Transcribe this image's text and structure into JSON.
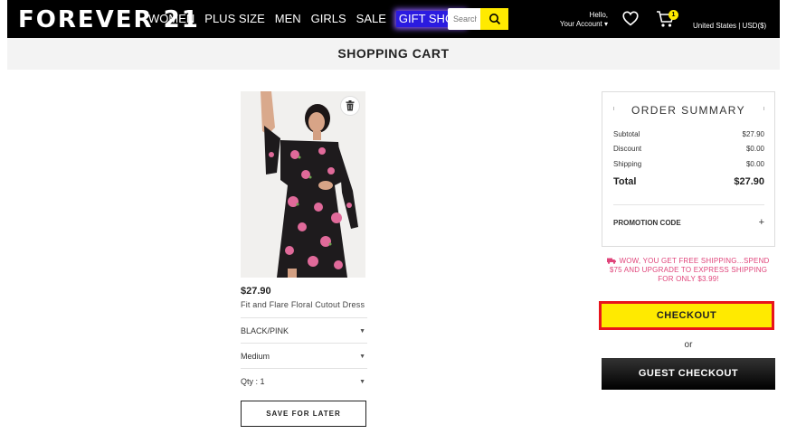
{
  "header": {
    "logo": "FOREVER 21",
    "nav": [
      "WOMEN",
      "PLUS SIZE",
      "MEN",
      "GIRLS",
      "SALE"
    ],
    "gift_shop": "GIFT SHOP",
    "search_placeholder": "Search",
    "account_line1": "Hello,",
    "account_line2": "Your Account",
    "cart_count": "1",
    "region": "United States | USD($)"
  },
  "page_title": "SHOPPING CART",
  "item": {
    "price": "$27.90",
    "name": "Fit and Flare Floral Cutout Dress",
    "color": "BLACK/PINK",
    "size": "Medium",
    "qty": "Qty : 1",
    "save_later": "SAVE FOR LATER"
  },
  "summary": {
    "title": "ORDER SUMMARY",
    "rows": [
      {
        "label": "Subtotal",
        "value": "$27.90"
      },
      {
        "label": "Discount",
        "value": "$0.00"
      },
      {
        "label": "Shipping",
        "value": "$0.00"
      }
    ],
    "total_label": "Total",
    "total_value": "$27.90",
    "promo_label": "PROMOTION CODE",
    "promo_toggle": "+"
  },
  "shipping_message": "WOW, YOU GET FREE SHIPPING...SPEND $75 AND UPGRADE TO EXPRESS SHIPPING FOR ONLY $3.99!",
  "checkout_label": "CHECKOUT",
  "or_label": "or",
  "guest_checkout_label": "GUEST CHECKOUT",
  "colors": {
    "accent_yellow": "#ffea00",
    "highlight_red": "#e8141c",
    "promo_pink": "#e0457b",
    "gift_blue": "#2b1be0"
  }
}
